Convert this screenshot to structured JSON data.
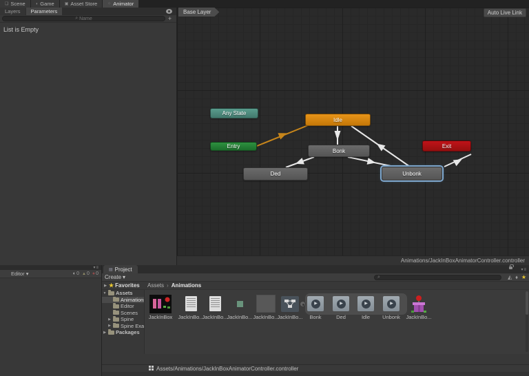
{
  "icons": {
    "scene": "❏",
    "game": "◗",
    "asset_store": "▣",
    "animator": "⁘",
    "search": "⌕",
    "dropdown": "▾",
    "breadcrumb_sep": "›",
    "foldout_open": "▼",
    "foldout_closed": "▶",
    "favorites_star": "★",
    "play": "▶",
    "panel_dropdown": "▾",
    "panel_menu": "≡",
    "info": "◐",
    "warning": "▲",
    "error": "●",
    "project_tab": "▤",
    "type_filter": "◭",
    "label_filter": "⬧"
  },
  "editor_tabs": {
    "items": [
      {
        "label": "Scene"
      },
      {
        "label": "Game"
      },
      {
        "label": "Asset Store"
      },
      {
        "label": "Animator",
        "active": true
      }
    ]
  },
  "animator": {
    "layers_tab": "Layers",
    "parameters_tab": "Parameters",
    "search_placeholder": "Name",
    "add_button": "+",
    "empty_text": "List is Empty",
    "breadcrumb": "Base Layer",
    "live_link_button": "Auto Live Link",
    "path_label": "Animations/JackInBoxAnimatorController.controller",
    "nodes": {
      "any_state": {
        "label": "Any State",
        "color": "#4E8F80"
      },
      "entry": {
        "label": "Entry",
        "color": "#1E7D2F"
      },
      "idle": {
        "label": "Idle",
        "color": "#D7860E"
      },
      "bonk": {
        "label": "Bonk",
        "color": "#5E5E5E"
      },
      "ded": {
        "label": "Ded",
        "color": "#5E5E5E"
      },
      "unbonk": {
        "label": "Unbonk",
        "color": "#5E5E5E",
        "selected": true,
        "selection_color": "#7FA8CE"
      },
      "exit": {
        "label": "Exit",
        "color": "#AD1218"
      }
    },
    "transitions": [
      {
        "from": "entry",
        "to": "idle",
        "color": "#C8861B"
      },
      {
        "from": "idle",
        "to": "bonk",
        "color": "#E8E8E8"
      },
      {
        "from": "bonk",
        "to": "ded",
        "color": "#E8E8E8"
      },
      {
        "from": "bonk",
        "to": "unbonk",
        "color": "#E8E8E8"
      },
      {
        "from": "unbonk",
        "to": "idle",
        "color": "#E8E8E8"
      },
      {
        "from": "unbonk",
        "to": "exit",
        "color": "#E8E8E8"
      }
    ]
  },
  "console": {
    "editor_dropdown": "Editor",
    "badges": [
      {
        "name": "info",
        "count": "0"
      },
      {
        "name": "warning",
        "count": "0"
      },
      {
        "name": "error",
        "count": "0"
      }
    ]
  },
  "project": {
    "tab_label": "Project",
    "create_button": "Create",
    "favorites_label": "Favorites",
    "breadcrumb": [
      "Assets",
      "Animations"
    ],
    "tree": [
      {
        "label": "Assets",
        "depth": 0,
        "expanded": true,
        "bold": true
      },
      {
        "label": "Animations",
        "depth": 1,
        "selected": true
      },
      {
        "label": "Editor",
        "depth": 1
      },
      {
        "label": "Scenes",
        "depth": 1
      },
      {
        "label": "Spine",
        "depth": 1,
        "collapsed": true
      },
      {
        "label": "Spine Examples",
        "depth": 1,
        "collapsed": true
      },
      {
        "label": "Packages",
        "depth": 0,
        "collapsed": true,
        "bold": true
      }
    ],
    "assets": [
      {
        "label": "JackInBox",
        "type": "sprite-sheet"
      },
      {
        "label": "JackInBo...",
        "type": "text-asset"
      },
      {
        "label": "JackInBo...",
        "type": "text-asset"
      },
      {
        "label": "JackInBo...",
        "type": "material"
      },
      {
        "label": "JackInBo...",
        "type": "texture"
      },
      {
        "label": "JackInBo...",
        "type": "animator-controller"
      },
      {
        "label": "Bonk",
        "type": "animation-clip"
      },
      {
        "label": "Ded",
        "type": "animation-clip"
      },
      {
        "label": "Idle",
        "type": "animation-clip"
      },
      {
        "label": "Unbonk",
        "type": "animation-clip"
      },
      {
        "label": "JackInBo...",
        "type": "prefab"
      }
    ],
    "status_path": "Assets/Animations/JackInBoxAnimatorController.controller"
  }
}
